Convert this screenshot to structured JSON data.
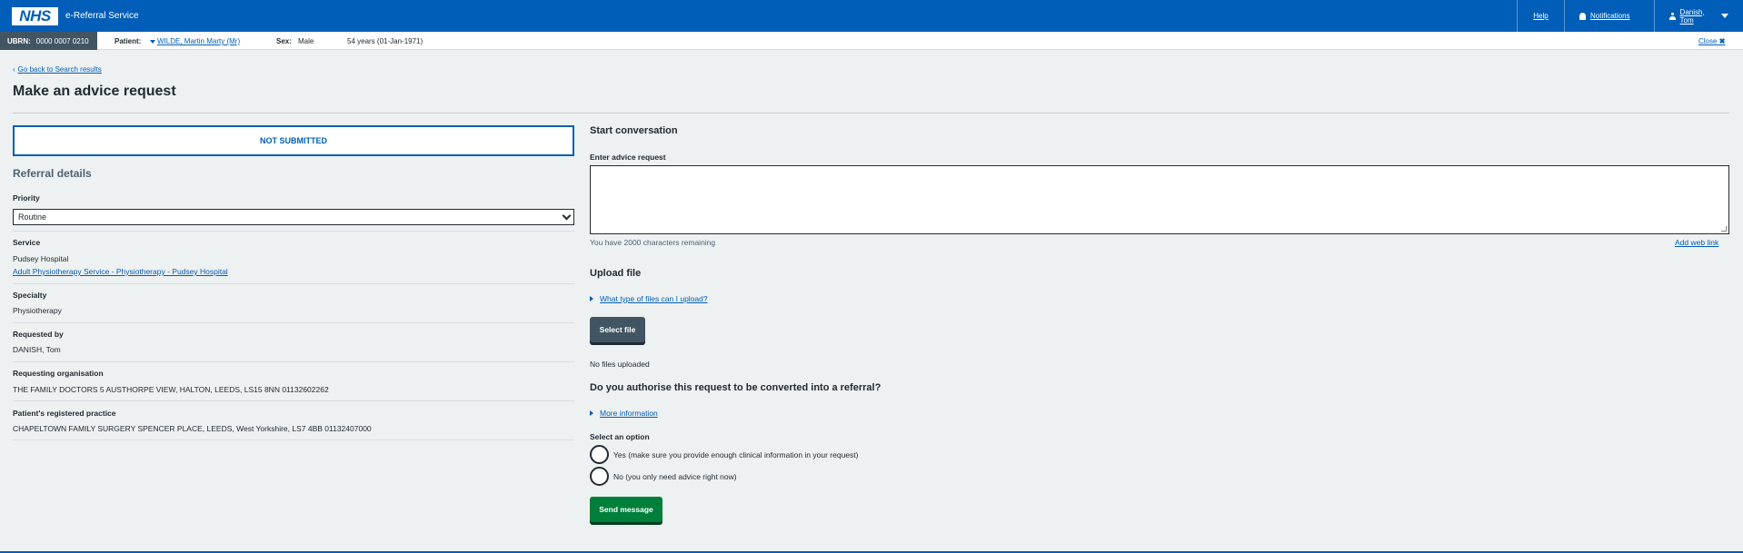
{
  "header": {
    "logo": "NHS",
    "app_title": "e-Referral Service",
    "help": "Help",
    "notifications": "Notifications",
    "user": "Danish, Tom"
  },
  "banner": {
    "ubrn_label": "UBRN:",
    "ubrn_value": "0000 0007 0210",
    "patient_label": "Patient:",
    "patient_name": "WILDE, Martin Marty (Mr)",
    "sex_label": "Sex:",
    "sex_value": "Male",
    "age": "54 years (01-Jan-1971)",
    "close": "Close"
  },
  "page": {
    "back_link": "Go back to Search results",
    "title": "Make an advice request"
  },
  "referral": {
    "status": "NOT SUBMITTED",
    "section_title": "Referral details",
    "priority_label": "Priority",
    "priority_value": "Routine",
    "service_label": "Service",
    "service_location": "Pudsey Hospital",
    "service_link": "Adult Physiotherapy Service - Physiotherapy - Pudsey Hospital",
    "specialty_label": "Specialty",
    "specialty_value": "Physiotherapy",
    "requested_by_label": "Requested by",
    "requested_by_value": "DANISH, Tom",
    "req_org_label": "Requesting organisation",
    "req_org_value": "THE FAMILY DOCTORS 5 AUSTHORPE VIEW, HALTON, LEEDS, LS15 8NN 01132602262",
    "practice_label": "Patient's registered practice",
    "practice_value": "CHAPELTOWN FAMILY SURGERY SPENCER PLACE, LEEDS, West Yorkshire, LS7 4BB 01132407000"
  },
  "conversation": {
    "title": "Start conversation",
    "input_label": "Enter advice request",
    "input_value": "",
    "chars_remaining": "You have 2000 characters remaining",
    "add_web_link": "Add web link",
    "upload_title": "Upload file",
    "upload_help": "What type of files can I upload?",
    "select_file": "Select file",
    "no_files": "No files uploaded",
    "authorise_title": "Do you authorise this request to be converted into a referral?",
    "more_info": "More information",
    "select_option": "Select an option",
    "option_yes": "Yes (make sure you provide enough clinical information in your request)",
    "option_no": "No (you only need advice right now)",
    "send": "Send message"
  },
  "colors": {
    "nhs_blue": "#005eb8",
    "background": "#eef1f1",
    "button_grey": "#425563",
    "button_green": "#007f3b"
  }
}
